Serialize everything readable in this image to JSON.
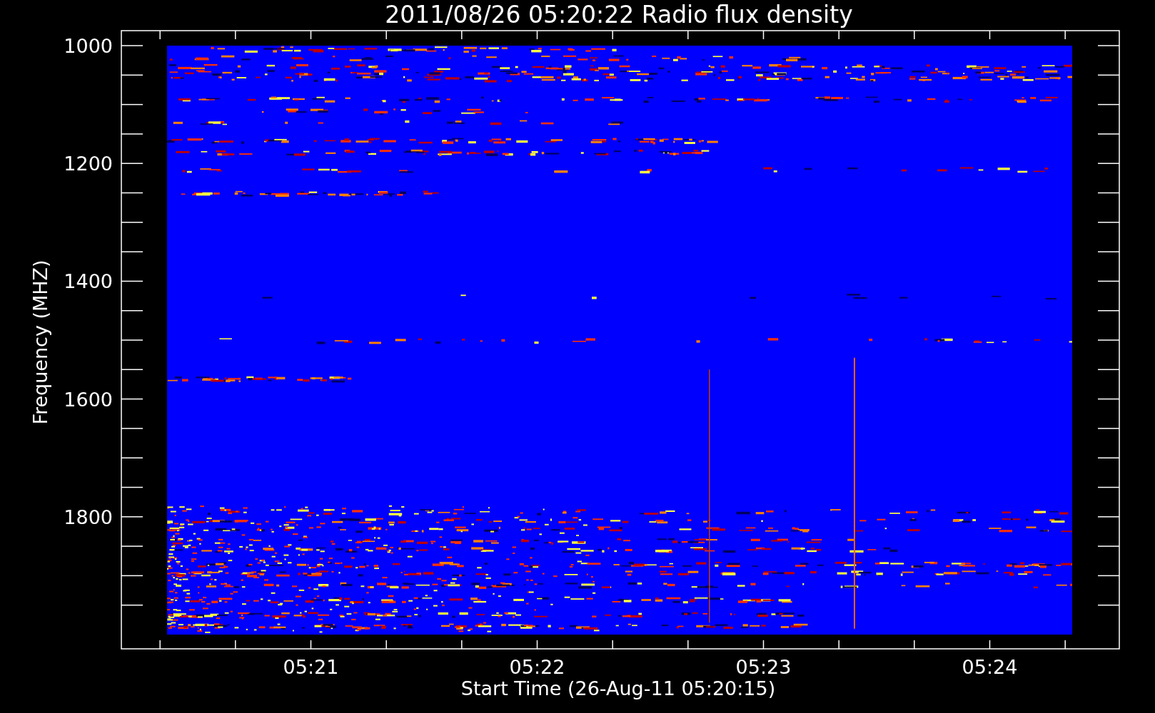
{
  "title": "2011/08/26 05:20:22 Radio flux density",
  "y_axis": {
    "label": "Frequency (MHZ)",
    "ticks": [
      "1000",
      "1200",
      "1400",
      "1600",
      "1800"
    ]
  },
  "x_axis": {
    "label": "Start Time (26-Aug-11 05:20:15)",
    "ticks": [
      "05:21",
      "05:22",
      "05:23",
      "05:24"
    ]
  }
}
